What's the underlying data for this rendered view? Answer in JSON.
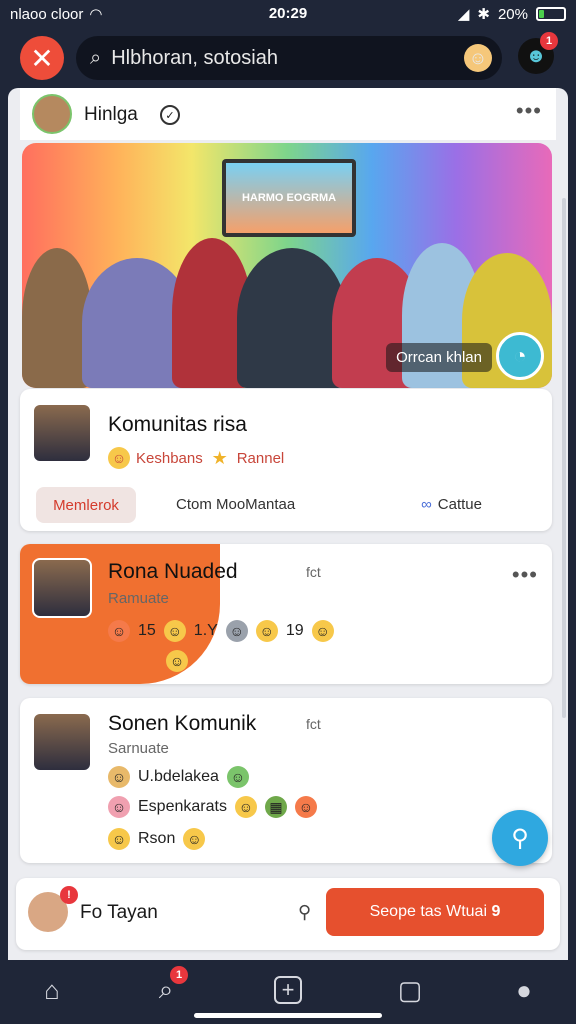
{
  "status": {
    "carrier": "nlaoo cloor",
    "time": "20:29",
    "battery": "20%",
    "battery_level": 0.2
  },
  "appbar": {
    "search_text": "Hlbhoran, sotosiah",
    "notif_badge": "1"
  },
  "post": {
    "author": "Hinlga",
    "hero_screen_text": "HARMO EOGRMA",
    "hero_caption": "Orrcan khlan"
  },
  "community_card": {
    "title": "Komunitas risa",
    "tags": [
      "Keshbans",
      "Rannel"
    ],
    "actions": {
      "primary": "Memlerok",
      "middle": "Ctom MooMantaa",
      "right": "Cattue"
    }
  },
  "card2": {
    "title": "Rona Nuaded",
    "subtitle": "Ramuate",
    "meta": "fct",
    "reactions": [
      "15",
      "1.Y",
      "19"
    ]
  },
  "card3": {
    "title": "Sonen Komunik",
    "subtitle": "Sarnuate",
    "meta": "fct",
    "lines": [
      "U.bdelakea",
      "Espenkarats",
      "Rson"
    ]
  },
  "bottom_card": {
    "name": "Fo Tayan",
    "cta": "Seope tas Wtuai",
    "cta_count": "9"
  },
  "navbar": {
    "search_badge": "1"
  },
  "colors": {
    "accent_red": "#ee4d3a",
    "cta_orange": "#e6502e",
    "fab_blue": "#2fa8e0",
    "bar_dark": "#1f2638"
  }
}
